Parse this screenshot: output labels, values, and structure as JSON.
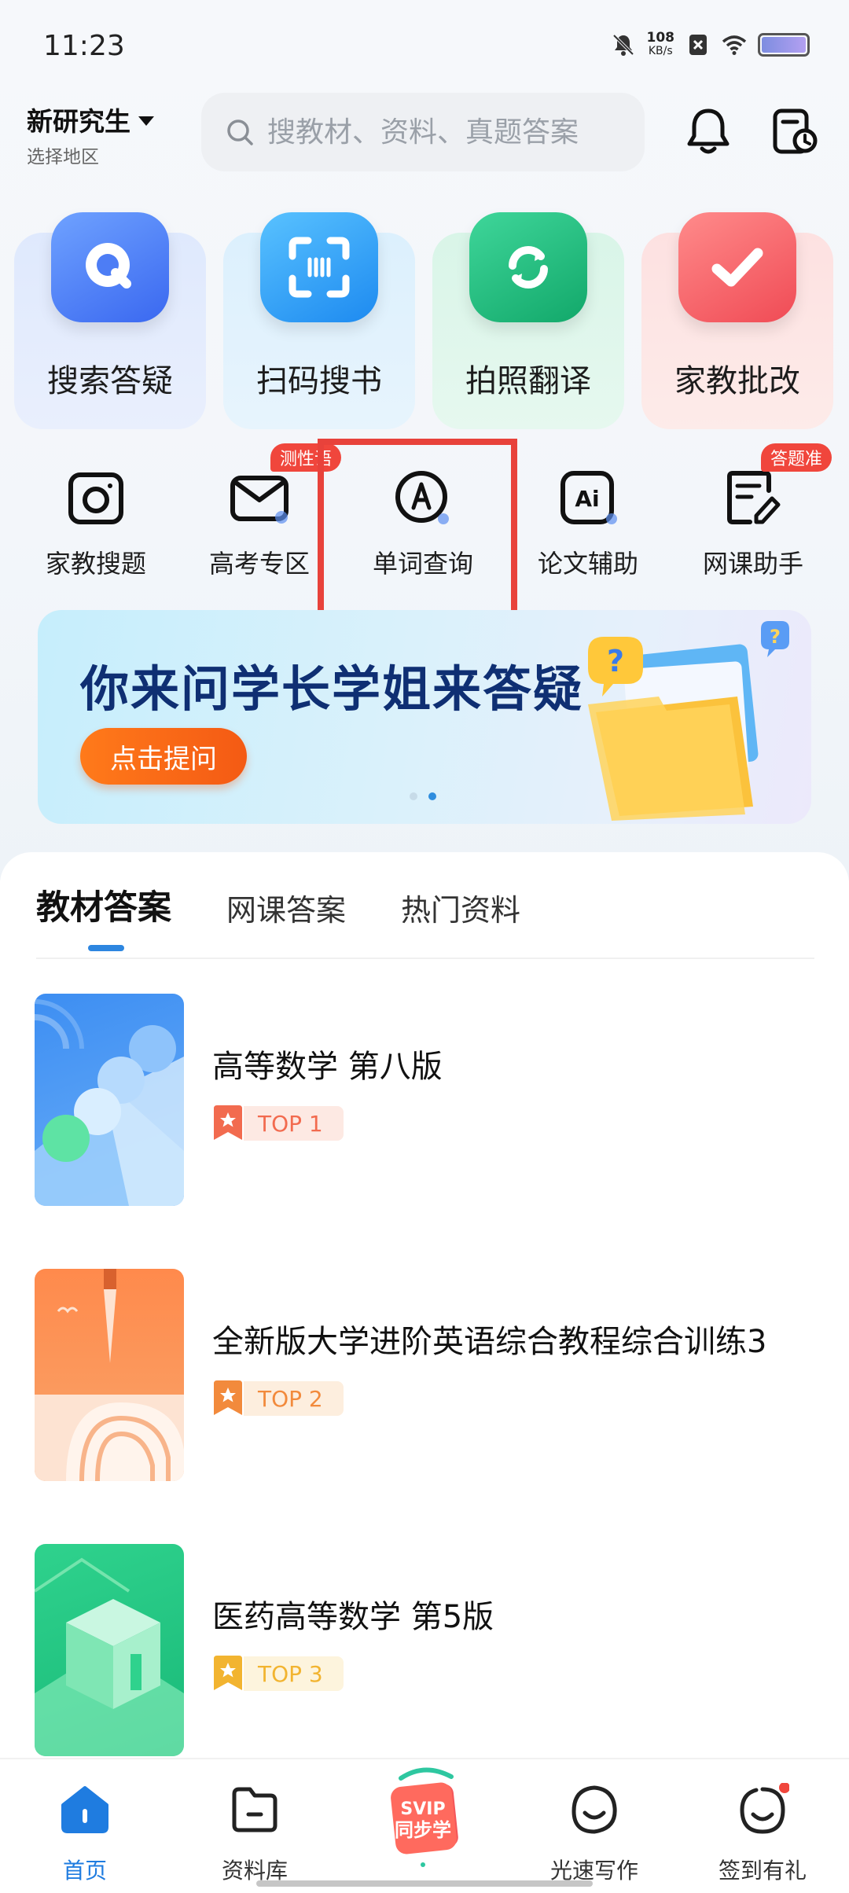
{
  "status_bar": {
    "time": "11:23",
    "net_speed_value": "108",
    "net_speed_unit": "KB/s"
  },
  "header": {
    "region_title": "新研究生",
    "region_subtitle": "选择地区",
    "search_placeholder": "搜教材、资料、真题答案"
  },
  "features": [
    {
      "label": "搜索答疑",
      "icon": "search-q-icon",
      "color": "#3f7bf4"
    },
    {
      "label": "扫码搜书",
      "icon": "scan-icon",
      "color": "#2f9cf3"
    },
    {
      "label": "拍照翻译",
      "icon": "translate-camera-icon",
      "color": "#1fbf7e"
    },
    {
      "label": "家教批改",
      "icon": "check-correct-icon",
      "color": "#f3545a"
    }
  ],
  "tools": [
    {
      "label": "家教搜题",
      "icon": "camera-icon"
    },
    {
      "label": "高考专区",
      "icon": "envelope-icon",
      "tag": "测性语"
    },
    {
      "label": "单词查询",
      "icon": "word-a-icon"
    },
    {
      "label": "论文辅助",
      "icon": "ai-icon"
    },
    {
      "label": "网课助手",
      "icon": "notepad-icon",
      "tag": "答题准"
    }
  ],
  "banner": {
    "title": "你来问学长学姐来答疑",
    "button": "点击提问"
  },
  "tabs": [
    "教材答案",
    "网课答案",
    "热门资料"
  ],
  "books": [
    {
      "title": "高等数学 第八版",
      "rank": "TOP 1",
      "rank_color": "#f26b4f",
      "rank_bg": "#fde9e3"
    },
    {
      "title": "全新版大学进阶英语综合教程综合训练3",
      "rank": "TOP 2",
      "rank_color": "#f28a3c",
      "rank_bg": "#fdeede"
    },
    {
      "title": "医药高等数学 第5版",
      "rank": "TOP 3",
      "rank_color": "#f2b430",
      "rank_bg": "#fdf4dd"
    }
  ],
  "bottom_nav": [
    {
      "label": "首页",
      "active": true
    },
    {
      "label": "资料库",
      "active": false
    },
    {
      "label": "",
      "svip_line1": "SVIP",
      "svip_line2": "同步学"
    },
    {
      "label": "光速写作",
      "active": false
    },
    {
      "label": "签到有礼",
      "active": false
    }
  ]
}
